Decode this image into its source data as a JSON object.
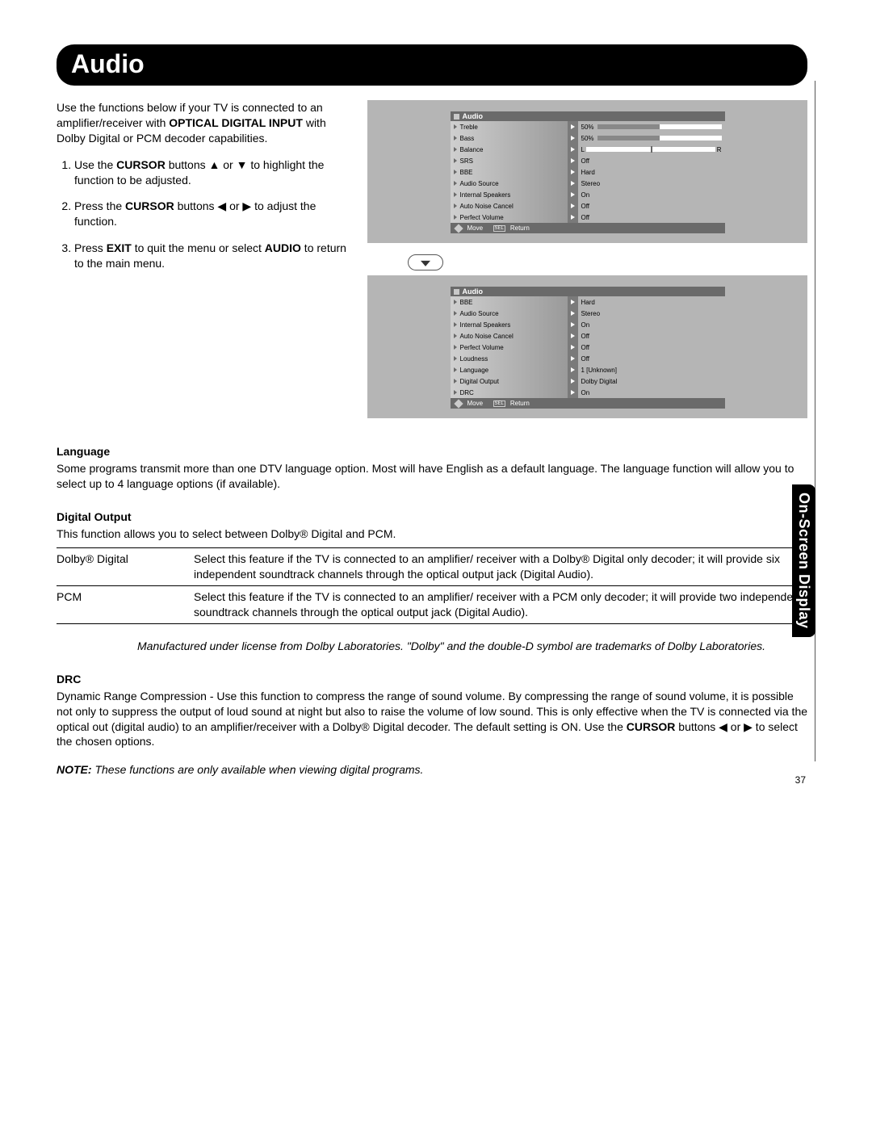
{
  "title": "Audio",
  "sideTab": "On-Screen Display",
  "pageNumber": "37",
  "intro": "Use the functions below if your TV is connected to an amplifier/receiver with OPTICAL DIGITAL INPUT with Dolby Digital or PCM decoder capabilities.",
  "steps": [
    "Use the CURSOR buttons ▲ or ▼ to highlight the function to be adjusted.",
    "Press the CURSOR buttons ◀ or ▶ to adjust the function.",
    "Press EXIT to quit the menu or select AUDIO to return to the main menu."
  ],
  "osd1": {
    "header": "Audio",
    "rows": [
      {
        "label": "Treble",
        "value": "50%",
        "type": "bar"
      },
      {
        "label": "Bass",
        "value": "50%",
        "type": "bar"
      },
      {
        "label": "Balance",
        "value": "L|R",
        "type": "balance"
      },
      {
        "label": "SRS",
        "value": "Off",
        "type": "text"
      },
      {
        "label": "BBE",
        "value": "Hard",
        "type": "text"
      },
      {
        "label": "Audio Source",
        "value": "Stereo",
        "type": "text"
      },
      {
        "label": "Internal Speakers",
        "value": "On",
        "type": "text"
      },
      {
        "label": "Auto Noise Cancel",
        "value": "Off",
        "type": "text"
      },
      {
        "label": "Perfect Volume",
        "value": "Off",
        "type": "text"
      }
    ],
    "footer": {
      "move": "Move",
      "sel": "SEL",
      "ret": "Return"
    }
  },
  "osd2": {
    "header": "Audio",
    "rows": [
      {
        "label": "BBE",
        "value": "Hard",
        "type": "text"
      },
      {
        "label": "Audio Source",
        "value": "Stereo",
        "type": "text"
      },
      {
        "label": "Internal Speakers",
        "value": "On",
        "type": "text"
      },
      {
        "label": "Auto Noise Cancel",
        "value": "Off",
        "type": "text"
      },
      {
        "label": "Perfect Volume",
        "value": "Off",
        "type": "text"
      },
      {
        "label": "Loudness",
        "value": "Off",
        "type": "text"
      },
      {
        "label": "Language",
        "value": "1 [Unknown]",
        "type": "text"
      },
      {
        "label": "Digital Output",
        "value": "Dolby Digital",
        "type": "text"
      },
      {
        "label": "DRC",
        "value": "On",
        "type": "text"
      }
    ],
    "footer": {
      "move": "Move",
      "sel": "SEL",
      "ret": "Return"
    }
  },
  "sections": {
    "language": {
      "heading": "Language",
      "body": "Some programs transmit more than one DTV language option. Most will have English as a default language. The language function will allow you to select up to 4 language options (if available)."
    },
    "digitalOutput": {
      "heading": "Digital Output",
      "body": "This function allows you to select between Dolby® Digital and PCM.",
      "table": [
        {
          "term": "Dolby® Digital",
          "def": "Select this feature if the TV is connected to an amplifier/ receiver with a Dolby® Digital only decoder; it will provide six independent soundtrack channels through the optical output jack (Digital Audio)."
        },
        {
          "term": "PCM",
          "def": "Select this feature if the TV is connected to an amplifier/ receiver with a PCM only decoder; it will provide two independent soundtrack channels through the optical output jack (Digital Audio)."
        }
      ],
      "license": "Manufactured under license from Dolby Laboratories. \"Dolby\" and the double-D symbol are trademarks of Dolby Laboratories."
    },
    "drc": {
      "heading": "DRC",
      "body": "Dynamic Range Compression - Use this function to compress the range of sound volume. By compressing the range of sound volume, it is possible not only to suppress the output of loud sound at night but also to raise the volume of low sound. This is only effective when the TV is connected via the optical out (digital audio) to an amplifier/receiver with a Dolby® Digital decoder. The default setting is ON. Use the CURSOR buttons ◀ or ▶ to select the chosen options."
    }
  },
  "note": {
    "label": "NOTE:",
    "text": "These functions are only available when viewing digital programs."
  }
}
